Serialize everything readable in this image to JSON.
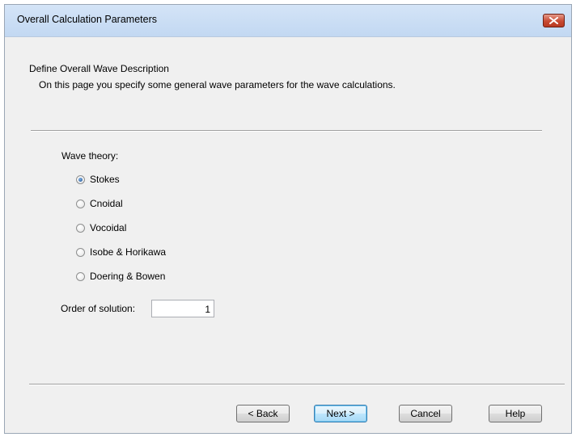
{
  "window": {
    "title": "Overall Calculation Parameters",
    "close_icon": "close-icon"
  },
  "page": {
    "heading": "Define Overall Wave Description",
    "description": "On this page you specify some general wave parameters for the wave calculations."
  },
  "wave_theory": {
    "label": "Wave theory:",
    "selected": "Stokes",
    "options": [
      "Stokes",
      "Cnoidal",
      "Vocoidal",
      "Isobe & Horikawa",
      "Doering & Bowen"
    ]
  },
  "order_of_solution": {
    "label": "Order of solution:",
    "value": "1"
  },
  "buttons": {
    "back": "< Back",
    "next": "Next >",
    "cancel": "Cancel",
    "help": "Help"
  },
  "colors": {
    "dialog_background": "#f0f0f0",
    "titlebar": "#c2d8f2",
    "close_button": "#c84a32",
    "default_button_border": "#3c7fb1"
  }
}
